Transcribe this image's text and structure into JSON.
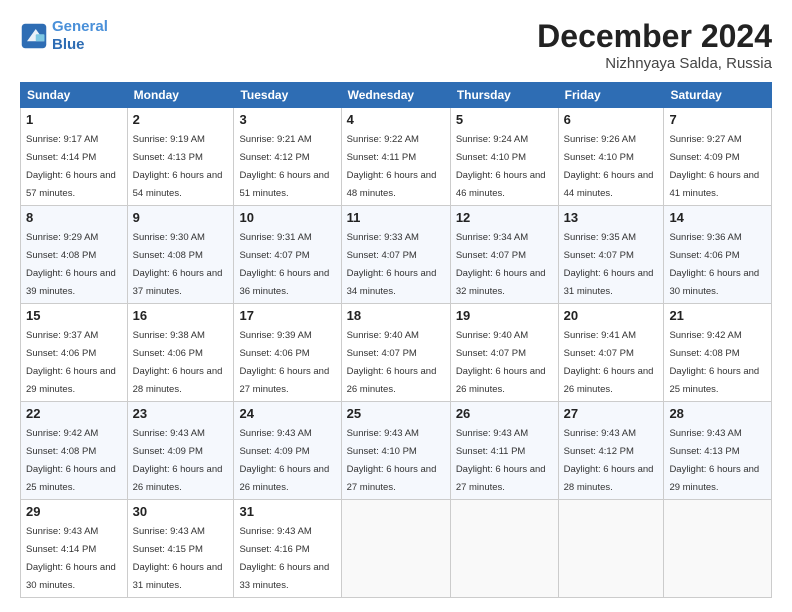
{
  "header": {
    "logo_line1": "General",
    "logo_line2": "Blue",
    "month": "December 2024",
    "location": "Nizhnyaya Salda, Russia"
  },
  "weekdays": [
    "Sunday",
    "Monday",
    "Tuesday",
    "Wednesday",
    "Thursday",
    "Friday",
    "Saturday"
  ],
  "weeks": [
    [
      {
        "day": "1",
        "sunrise": "9:17 AM",
        "sunset": "4:14 PM",
        "daylight": "6 hours and 57 minutes."
      },
      {
        "day": "2",
        "sunrise": "9:19 AM",
        "sunset": "4:13 PM",
        "daylight": "6 hours and 54 minutes."
      },
      {
        "day": "3",
        "sunrise": "9:21 AM",
        "sunset": "4:12 PM",
        "daylight": "6 hours and 51 minutes."
      },
      {
        "day": "4",
        "sunrise": "9:22 AM",
        "sunset": "4:11 PM",
        "daylight": "6 hours and 48 minutes."
      },
      {
        "day": "5",
        "sunrise": "9:24 AM",
        "sunset": "4:10 PM",
        "daylight": "6 hours and 46 minutes."
      },
      {
        "day": "6",
        "sunrise": "9:26 AM",
        "sunset": "4:10 PM",
        "daylight": "6 hours and 44 minutes."
      },
      {
        "day": "7",
        "sunrise": "9:27 AM",
        "sunset": "4:09 PM",
        "daylight": "6 hours and 41 minutes."
      }
    ],
    [
      {
        "day": "8",
        "sunrise": "9:29 AM",
        "sunset": "4:08 PM",
        "daylight": "6 hours and 39 minutes."
      },
      {
        "day": "9",
        "sunrise": "9:30 AM",
        "sunset": "4:08 PM",
        "daylight": "6 hours and 37 minutes."
      },
      {
        "day": "10",
        "sunrise": "9:31 AM",
        "sunset": "4:07 PM",
        "daylight": "6 hours and 36 minutes."
      },
      {
        "day": "11",
        "sunrise": "9:33 AM",
        "sunset": "4:07 PM",
        "daylight": "6 hours and 34 minutes."
      },
      {
        "day": "12",
        "sunrise": "9:34 AM",
        "sunset": "4:07 PM",
        "daylight": "6 hours and 32 minutes."
      },
      {
        "day": "13",
        "sunrise": "9:35 AM",
        "sunset": "4:07 PM",
        "daylight": "6 hours and 31 minutes."
      },
      {
        "day": "14",
        "sunrise": "9:36 AM",
        "sunset": "4:06 PM",
        "daylight": "6 hours and 30 minutes."
      }
    ],
    [
      {
        "day": "15",
        "sunrise": "9:37 AM",
        "sunset": "4:06 PM",
        "daylight": "6 hours and 29 minutes."
      },
      {
        "day": "16",
        "sunrise": "9:38 AM",
        "sunset": "4:06 PM",
        "daylight": "6 hours and 28 minutes."
      },
      {
        "day": "17",
        "sunrise": "9:39 AM",
        "sunset": "4:06 PM",
        "daylight": "6 hours and 27 minutes."
      },
      {
        "day": "18",
        "sunrise": "9:40 AM",
        "sunset": "4:07 PM",
        "daylight": "6 hours and 26 minutes."
      },
      {
        "day": "19",
        "sunrise": "9:40 AM",
        "sunset": "4:07 PM",
        "daylight": "6 hours and 26 minutes."
      },
      {
        "day": "20",
        "sunrise": "9:41 AM",
        "sunset": "4:07 PM",
        "daylight": "6 hours and 26 minutes."
      },
      {
        "day": "21",
        "sunrise": "9:42 AM",
        "sunset": "4:08 PM",
        "daylight": "6 hours and 25 minutes."
      }
    ],
    [
      {
        "day": "22",
        "sunrise": "9:42 AM",
        "sunset": "4:08 PM",
        "daylight": "6 hours and 25 minutes."
      },
      {
        "day": "23",
        "sunrise": "9:43 AM",
        "sunset": "4:09 PM",
        "daylight": "6 hours and 26 minutes."
      },
      {
        "day": "24",
        "sunrise": "9:43 AM",
        "sunset": "4:09 PM",
        "daylight": "6 hours and 26 minutes."
      },
      {
        "day": "25",
        "sunrise": "9:43 AM",
        "sunset": "4:10 PM",
        "daylight": "6 hours and 27 minutes."
      },
      {
        "day": "26",
        "sunrise": "9:43 AM",
        "sunset": "4:11 PM",
        "daylight": "6 hours and 27 minutes."
      },
      {
        "day": "27",
        "sunrise": "9:43 AM",
        "sunset": "4:12 PM",
        "daylight": "6 hours and 28 minutes."
      },
      {
        "day": "28",
        "sunrise": "9:43 AM",
        "sunset": "4:13 PM",
        "daylight": "6 hours and 29 minutes."
      }
    ],
    [
      {
        "day": "29",
        "sunrise": "9:43 AM",
        "sunset": "4:14 PM",
        "daylight": "6 hours and 30 minutes."
      },
      {
        "day": "30",
        "sunrise": "9:43 AM",
        "sunset": "4:15 PM",
        "daylight": "6 hours and 31 minutes."
      },
      {
        "day": "31",
        "sunrise": "9:43 AM",
        "sunset": "4:16 PM",
        "daylight": "6 hours and 33 minutes."
      },
      null,
      null,
      null,
      null
    ]
  ]
}
